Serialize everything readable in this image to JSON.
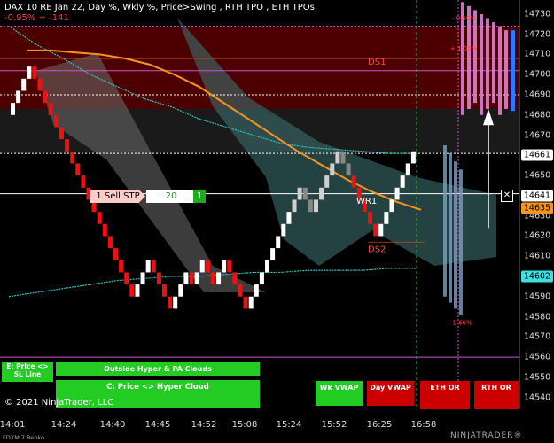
{
  "header": {
    "title": "DAX 10 RE Jan 22, Day %, Wkly %, Price>Swing  , RTH TPO , ETH TPOs",
    "change": "-0.95% = -141"
  },
  "colors": {
    "up": "#ffffff",
    "down": "#ee1111",
    "neutral": "#888888",
    "ema": "#f7941d",
    "vwap": "#2ec4c4",
    "cloud_teal": "#3e6e6e",
    "cloud_gray": "#6e6e6e",
    "value_area": "#5a0000",
    "last_price": "#ffffff",
    "green_button": "#22cc22",
    "red_button": "#cc0000"
  },
  "chart_data": {
    "type": "line",
    "instrument": "FDXM 7 Renko",
    "ylim": [
      14535,
      14737
    ],
    "y_ticks": [
      14730,
      14720,
      14710,
      14700,
      14690,
      14680,
      14670,
      14660,
      14650,
      14640,
      14630,
      14620,
      14610,
      14600,
      14590,
      14580,
      14570,
      14560,
      14550,
      14540
    ],
    "x_ticks": [
      "14:01",
      "14:24",
      "14:40",
      "14:45",
      "14:52",
      "15:08",
      "15:24",
      "15:52",
      "16:25",
      "16:58"
    ],
    "renko_bricks": [
      {
        "o": 14680,
        "c": 14686,
        "dir": "up"
      },
      {
        "o": 14686,
        "c": 14692,
        "dir": "up"
      },
      {
        "o": 14692,
        "c": 14698,
        "dir": "up"
      },
      {
        "o": 14698,
        "c": 14704,
        "dir": "up"
      },
      {
        "o": 14704,
        "c": 14698,
        "dir": "down"
      },
      {
        "o": 14698,
        "c": 14692,
        "dir": "down"
      },
      {
        "o": 14692,
        "c": 14686,
        "dir": "down"
      },
      {
        "o": 14686,
        "c": 14680,
        "dir": "down"
      },
      {
        "o": 14680,
        "c": 14674,
        "dir": "down"
      },
      {
        "o": 14674,
        "c": 14668,
        "dir": "down"
      },
      {
        "o": 14668,
        "c": 14662,
        "dir": "down"
      },
      {
        "o": 14662,
        "c": 14656,
        "dir": "down"
      },
      {
        "o": 14656,
        "c": 14650,
        "dir": "down"
      },
      {
        "o": 14650,
        "c": 14644,
        "dir": "down"
      },
      {
        "o": 14644,
        "c": 14638,
        "dir": "down"
      },
      {
        "o": 14638,
        "c": 14632,
        "dir": "down"
      },
      {
        "o": 14632,
        "c": 14626,
        "dir": "down"
      },
      {
        "o": 14626,
        "c": 14620,
        "dir": "down"
      },
      {
        "o": 14620,
        "c": 14614,
        "dir": "down"
      },
      {
        "o": 14614,
        "c": 14608,
        "dir": "down"
      },
      {
        "o": 14608,
        "c": 14602,
        "dir": "down"
      },
      {
        "o": 14602,
        "c": 14596,
        "dir": "down"
      },
      {
        "o": 14596,
        "c": 14590,
        "dir": "down"
      },
      {
        "o": 14590,
        "c": 14596,
        "dir": "up"
      },
      {
        "o": 14596,
        "c": 14602,
        "dir": "up"
      },
      {
        "o": 14602,
        "c": 14608,
        "dir": "up"
      },
      {
        "o": 14608,
        "c": 14602,
        "dir": "down"
      },
      {
        "o": 14602,
        "c": 14596,
        "dir": "down"
      },
      {
        "o": 14596,
        "c": 14590,
        "dir": "down"
      },
      {
        "o": 14590,
        "c": 14584,
        "dir": "down"
      },
      {
        "o": 14584,
        "c": 14590,
        "dir": "up"
      },
      {
        "o": 14590,
        "c": 14596,
        "dir": "up"
      },
      {
        "o": 14596,
        "c": 14602,
        "dir": "up"
      },
      {
        "o": 14602,
        "c": 14596,
        "dir": "down"
      },
      {
        "o": 14596,
        "c": 14602,
        "dir": "up"
      },
      {
        "o": 14602,
        "c": 14608,
        "dir": "up"
      },
      {
        "o": 14608,
        "c": 14602,
        "dir": "down"
      },
      {
        "o": 14602,
        "c": 14596,
        "dir": "down"
      },
      {
        "o": 14596,
        "c": 14602,
        "dir": "up"
      },
      {
        "o": 14602,
        "c": 14608,
        "dir": "up"
      },
      {
        "o": 14608,
        "c": 14602,
        "dir": "down"
      },
      {
        "o": 14602,
        "c": 14596,
        "dir": "down"
      },
      {
        "o": 14596,
        "c": 14590,
        "dir": "down"
      },
      {
        "o": 14590,
        "c": 14584,
        "dir": "down"
      },
      {
        "o": 14584,
        "c": 14590,
        "dir": "up"
      },
      {
        "o": 14590,
        "c": 14596,
        "dir": "up"
      },
      {
        "o": 14596,
        "c": 14602,
        "dir": "up"
      },
      {
        "o": 14602,
        "c": 14608,
        "dir": "up"
      },
      {
        "o": 14608,
        "c": 14614,
        "dir": "up"
      },
      {
        "o": 14614,
        "c": 14620,
        "dir": "up"
      },
      {
        "o": 14620,
        "c": 14626,
        "dir": "up"
      },
      {
        "o": 14626,
        "c": 14632,
        "dir": "up"
      },
      {
        "o": 14632,
        "c": 14638,
        "dir": "up"
      },
      {
        "o": 14638,
        "c": 14644,
        "dir": "up"
      },
      {
        "o": 14644,
        "c": 14638,
        "dir": "down"
      },
      {
        "o": 14638,
        "c": 14632,
        "dir": "down"
      },
      {
        "o": 14632,
        "c": 14638,
        "dir": "up"
      },
      {
        "o": 14638,
        "c": 14644,
        "dir": "up"
      },
      {
        "o": 14644,
        "c": 14650,
        "dir": "up"
      },
      {
        "o": 14650,
        "c": 14656,
        "dir": "up"
      },
      {
        "o": 14656,
        "c": 14662,
        "dir": "up"
      },
      {
        "o": 14662,
        "c": 14656,
        "dir": "down"
      },
      {
        "o": 14656,
        "c": 14650,
        "dir": "down"
      },
      {
        "o": 14650,
        "c": 14644,
        "dir": "down"
      },
      {
        "o": 14644,
        "c": 14638,
        "dir": "down"
      },
      {
        "o": 14638,
        "c": 14632,
        "dir": "down"
      },
      {
        "o": 14632,
        "c": 14626,
        "dir": "down"
      },
      {
        "o": 14626,
        "c": 14620,
        "dir": "down"
      },
      {
        "o": 14620,
        "c": 14626,
        "dir": "up"
      },
      {
        "o": 14626,
        "c": 14632,
        "dir": "up"
      },
      {
        "o": 14632,
        "c": 14638,
        "dir": "up"
      },
      {
        "o": 14638,
        "c": 14644,
        "dir": "up"
      },
      {
        "o": 14644,
        "c": 14650,
        "dir": "up"
      },
      {
        "o": 14650,
        "c": 14656,
        "dir": "up"
      },
      {
        "o": 14656,
        "c": 14662,
        "dir": "up"
      }
    ],
    "ema_series": [
      14712,
      14712,
      14711,
      14710,
      14708,
      14705,
      14700,
      14694,
      14686,
      14678,
      14670,
      14662,
      14655,
      14648,
      14642,
      14637,
      14633
    ],
    "vwap_upper_series": [
      14724,
      14715,
      14708,
      14700,
      14694,
      14688,
      14684,
      14678,
      14674,
      14670,
      14666,
      14664,
      14663,
      14662,
      14661,
      14661
    ],
    "vwap_lower_series": [
      14590,
      14592,
      14594,
      14596,
      14598,
      14599,
      14600,
      14600,
      14601,
      14602,
      14602,
      14603,
      14603,
      14603,
      14604,
      14604
    ],
    "levels": {
      "last_price": 14661,
      "order_price": 14641,
      "orange_tag": 14635,
      "cyan_tag": 14602,
      "va_high": 14724,
      "va_low": 14683
    },
    "annotations": [
      {
        "text": "DS1",
        "price": 14705
      },
      {
        "text": "WR1",
        "price": 14636
      },
      {
        "text": "DS2",
        "price": 14612
      },
      {
        "text": "- 0.50%",
        "price": 14727
      },
      {
        "text": "+ 1.00%",
        "price": 14712
      },
      {
        "text": "-1.66%",
        "price": 14576
      }
    ]
  },
  "order": {
    "label": "1 Sell STP",
    "quantity": "20",
    "count": "1",
    "cancel": "✕"
  },
  "price_tags": {
    "last": "14661",
    "order": "14641",
    "orange": "14635",
    "cyan": "14602"
  },
  "buttons": [
    {
      "label": "E: Price <> SL Line",
      "color": "green"
    },
    {
      "label": "Outside Hyper & PA Clouds",
      "color": "green"
    },
    {
      "label": "C: Price <> Hyper Cloud",
      "color": "green"
    },
    {
      "label": "Wk VWAP",
      "color": "green"
    },
    {
      "label": "Day VWAP",
      "color": "red"
    },
    {
      "label": "ETH OR",
      "color": "red"
    },
    {
      "label": "RTH OR",
      "color": "red"
    }
  ],
  "copyright": "© 2021 NinjaTrader, LLC",
  "instrument_footer": "FDXM 7 Renko",
  "brand": "NINJATRADER®"
}
